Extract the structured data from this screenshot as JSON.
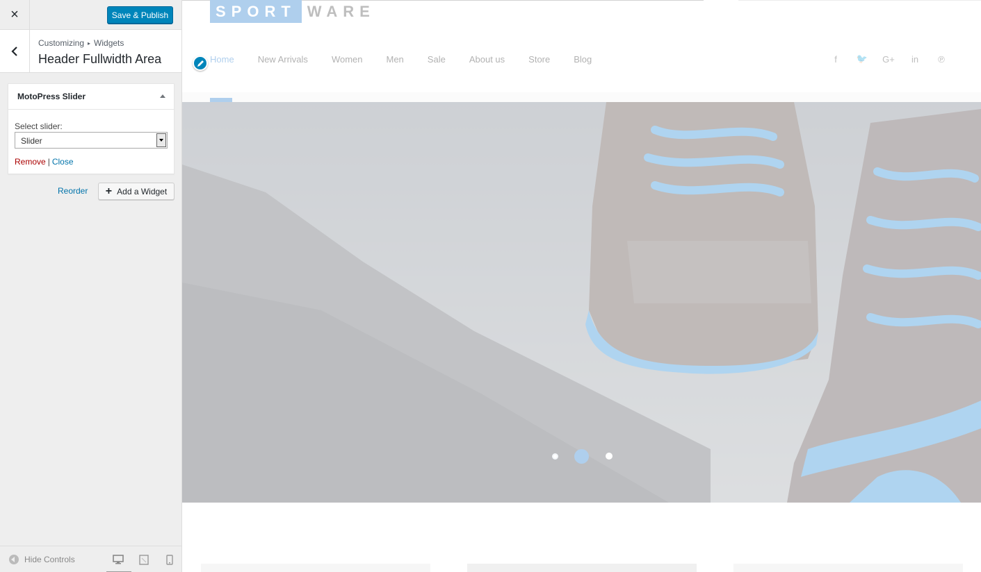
{
  "customizer": {
    "close_icon": "×",
    "save_label": "Save & Publish",
    "breadcrumb": {
      "root": "Customizing",
      "separator": "▸",
      "current": "Widgets"
    },
    "section_title": "Header Fullwidth Area",
    "widget": {
      "title": "MotoPress Slider",
      "field_label": "Select slider:",
      "select_value": "Slider",
      "remove_label": "Remove",
      "pipe": "|",
      "close_label": "Close"
    },
    "reorder_label": "Reorder",
    "add_widget_plus": "+",
    "add_widget_label": "Add a Widget",
    "hide_controls_label": "Hide Controls",
    "devices": [
      "desktop-icon",
      "tablet-icon",
      "mobile-icon"
    ],
    "active_device": "desktop",
    "colors": {
      "primary": "#0085ba",
      "remove": "#aa0000",
      "link": "#0073aa"
    }
  },
  "preview": {
    "logo": {
      "sport": "SPORT",
      "ware": "WARE"
    },
    "nav": [
      "Home",
      "New Arrivals",
      "Women",
      "Men",
      "Sale",
      "About us",
      "Store",
      "Blog"
    ],
    "active_nav": "Home",
    "social_icons": [
      "facebook-icon",
      "twitter-icon",
      "google-plus-icon",
      "linkedin-icon",
      "pinterest-icon"
    ],
    "social_glyphs": [
      "f",
      "🐦",
      "G+",
      "in",
      "℗"
    ],
    "slider": {
      "slide_count": 3,
      "active_slide": 2
    },
    "brand_color": "#2f80d0"
  }
}
